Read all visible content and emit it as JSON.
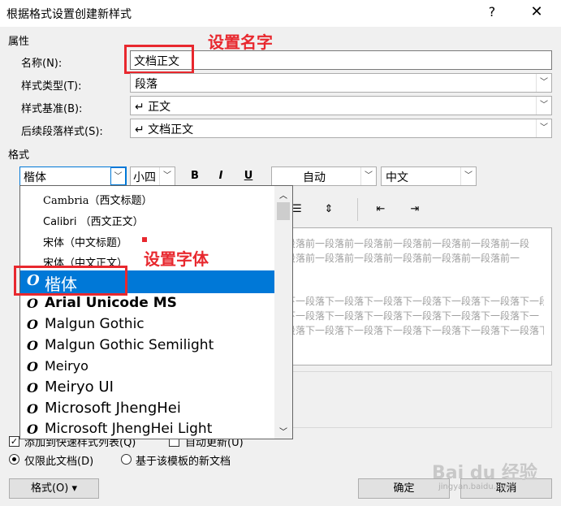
{
  "window": {
    "title": "根据格式设置创建新样式",
    "help": "?",
    "close": "✕"
  },
  "sections": {
    "properties": "属性",
    "format": "格式"
  },
  "fields": {
    "name_label": "名称(N):",
    "name_value": "文档正文",
    "style_type_label": "样式类型(T):",
    "style_type_value": "段落",
    "style_base_label": "样式基准(B):",
    "style_base_value": "↵ 正文",
    "next_style_label": "后续段落样式(S):",
    "next_style_value": "↵ 文档正文"
  },
  "annotations": {
    "set_name": "设置名字",
    "set_font": "设置字体"
  },
  "format_toolbar": {
    "font_value": "楷体",
    "size_value": "小四",
    "bold": "B",
    "italic": "I",
    "underline": "U",
    "color_value": "自动",
    "lang_value": "中文"
  },
  "font_list": [
    {
      "name": "Cambria（西文标题）",
      "icon": false
    },
    {
      "name": "Calibri （西文正文）",
      "icon": false
    },
    {
      "name": "宋体（中文标题）",
      "icon": false
    },
    {
      "name": "宋体（中文正文）",
      "icon": false
    },
    {
      "name": "楷体",
      "icon": true,
      "selected": true
    },
    {
      "name": "Arial Unicode MS",
      "icon": true
    },
    {
      "name": "Malgun Gothic",
      "icon": true
    },
    {
      "name": "Malgun Gothic Semilight",
      "icon": true
    },
    {
      "name": "Meiryo",
      "icon": true
    },
    {
      "name": "Meiryo UI",
      "icon": true
    },
    {
      "name": "Microsoft JhengHei",
      "icon": true
    },
    {
      "name": "Microsoft JhengHei Light",
      "icon": true
    }
  ],
  "preview": {
    "prev_lines": [
      "一段落前一段落前一段落前一段落前一段落前一段落前一段",
      "一段落前一段落前一段落前一段落前一段落前一段落前一"
    ],
    "next_lines": [
      "落下一段落下一段落下一段落下一段落下一段落下一段落下一段",
      "落下一段落下一段落下一段落下一段落下一段落下一段落下一",
      "一段落下一段落下一段落下一段落下一段落下一段落下一段落下"
    ]
  },
  "options": {
    "add_to_gallery": "添加到快速样式列表(Q)",
    "auto_update": "自动更新(U)",
    "this_doc_only": "仅限此文档(D)",
    "new_docs_template": "基于该模板的新文档"
  },
  "buttons": {
    "format": "格式(O) ▾",
    "ok": "确定",
    "cancel": "取消"
  },
  "watermark": {
    "logo": "Bai du 经验",
    "url": "jingyan.baidu.com"
  },
  "colors": {
    "accent": "#0078d7",
    "annotation": "#e8282e"
  }
}
